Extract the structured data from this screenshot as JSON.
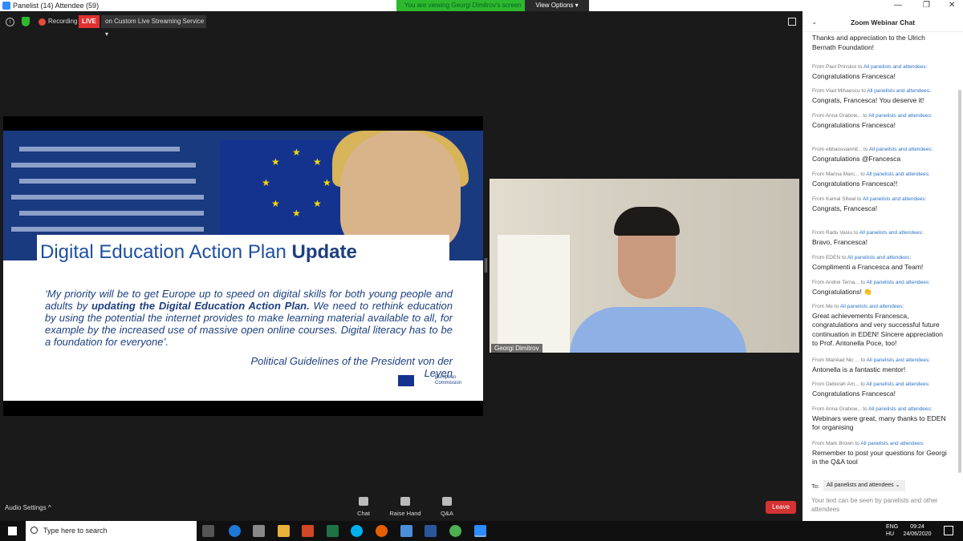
{
  "window": {
    "title": "Panelist (14) Attendee (59)",
    "viewing_banner": "You are viewing Georgi Dimitrov's screen",
    "view_options": "View Options ▾",
    "controls": [
      "—",
      "❐",
      "✕"
    ]
  },
  "topbar": {
    "recording": "Recording",
    "live": "LIVE",
    "live_service": "on Custom Live Streaming Service ▾"
  },
  "slide": {
    "title_regular": "Digital Education Action Plan ",
    "title_bold": "Update",
    "quote_start": "‘My priority will be to get Europe up to speed on digital skills for both young people and adults by ",
    "quote_bold": "updating the Digital Education Action Plan.",
    "quote_end": " We need to rethink education by using the potential the internet provides to make learning material available to all, for example by the increased use of massive open online courses. Digital literacy has to be a foundation for everyone’.",
    "attribution": "Political Guidelines of the President von der Leyen",
    "logo_text_1": "European",
    "logo_text_2": "Commission"
  },
  "video": {
    "name": "Georgi Dimitrov"
  },
  "toolbar": {
    "audio_settings": "Audio Settings ^",
    "chat": "Chat",
    "raise_hand": "Raise Hand",
    "qa": "Q&A",
    "leave": "Leave"
  },
  "chat": {
    "title": "Zoom Webinar Chat",
    "messages": [
      {
        "from": "",
        "to": "",
        "body": "Thanks and appreciation to the Ulrich Bernath Foundation!"
      },
      {
        "from": "From Paul Prinsloo to ",
        "to": "All panelists and attendees:",
        "body": "Congratulations Francesca!"
      },
      {
        "from": "From Vlad Mihaescu to ",
        "to": "All panelists and attendees:",
        "body": "Congrats, Francesca! You deserve it!"
      },
      {
        "from": "From Anna Grabow... to ",
        "to": "All panelists and attendees:",
        "body": "Congratulations Francesca!"
      },
      {
        "from": "From ebbaossiannil... to ",
        "to": "All panelists and attendees:",
        "body": "Congratulations @Francesca"
      },
      {
        "from": "From Marina Marc... to ",
        "to": "All panelists and attendees:",
        "body": "Congratulations Francesca!!"
      },
      {
        "from": "From Kamal Silwal to ",
        "to": "All panelists and attendees:",
        "body": "Congrats, Francesca!"
      },
      {
        "from": "From Radu Vasiu to ",
        "to": "All panelists and attendees:",
        "body": "Bravo, Francesca!"
      },
      {
        "from": "From EDEN to ",
        "to": "All panelists and attendees:",
        "body": "Complimenti a Francesca and Team!"
      },
      {
        "from": "From Andrei Terna... to ",
        "to": "All panelists and attendees:",
        "body": "Congratulations! 👏"
      },
      {
        "from": "From Me to ",
        "to": "All panelists and attendees:",
        "body": "Great achievements Francesca, congratulations and very successful future continuation in EDEN! Sincere appreciation to Prof. Antonella Poce, too!"
      },
      {
        "from": "From Mairéad Nic ... to ",
        "to": "All panelists and attendees:",
        "body": "Antonella is a fantastic mentor!"
      },
      {
        "from": "From Deborah Am... to ",
        "to": "All panelists and attendees:",
        "body": "Congratulations Francesca!"
      },
      {
        "from": "From Anna Grabow... to ",
        "to": "All panelists and attendees:",
        "body": "Webinars were great, many thanks to EDEN for organising"
      },
      {
        "from": "From Mark Brown to ",
        "to": "All panelists and attendees:",
        "body": "Remember to post your questions for Georgi in the Q&A tool"
      }
    ],
    "to_label": "To:",
    "to_value": "All panelists and attendees ⌄",
    "input_placeholder": "Your text can be seen by panelists and other attendees"
  },
  "taskbar": {
    "search_placeholder": "Type here to search",
    "lang_1": "ENG",
    "lang_2": "HU",
    "time": "09:24",
    "date": "24/06/2020"
  },
  "colors": {
    "zoom_blue": "#2d8cff",
    "live_red": "#e03030",
    "viewing_green": "#2eb82e",
    "leave_red": "#d43333",
    "link_blue": "#2d73c6"
  }
}
